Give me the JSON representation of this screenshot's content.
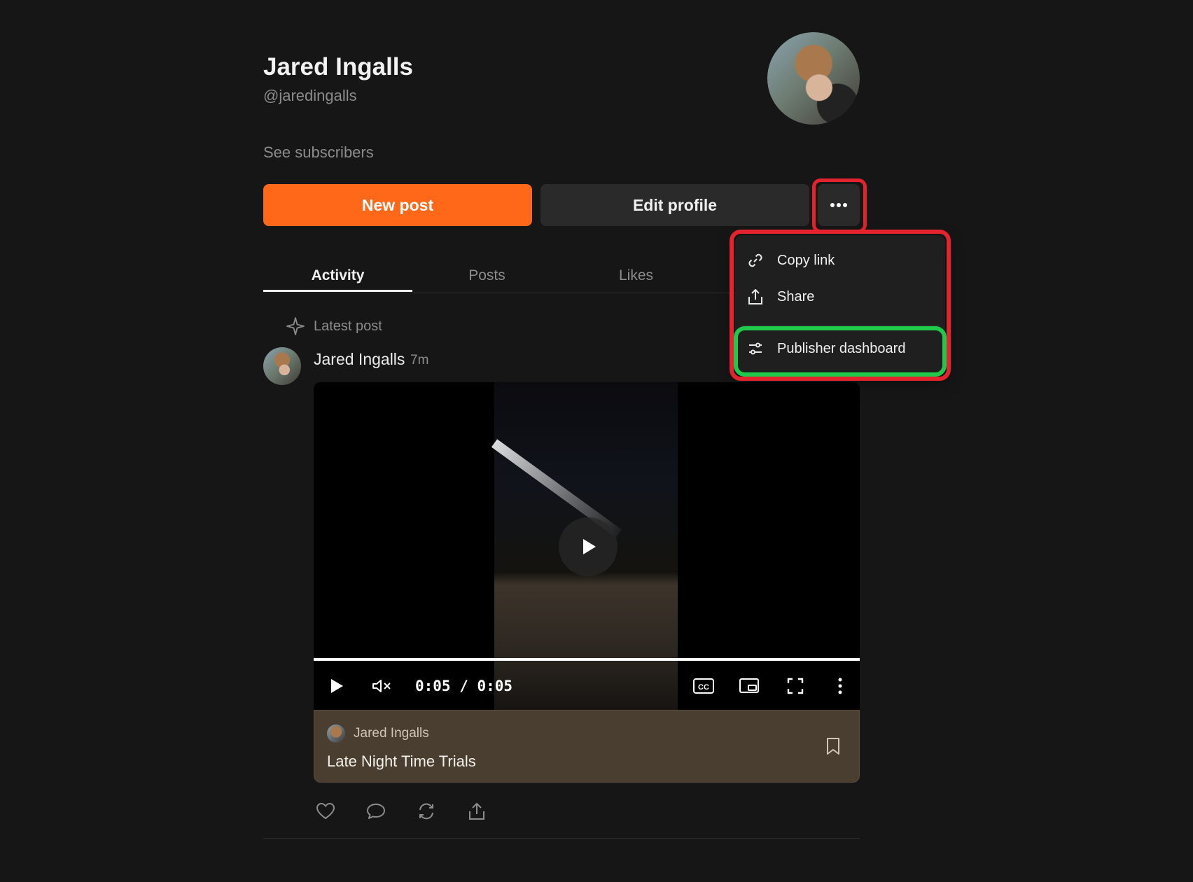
{
  "profile": {
    "name": "Jared Ingalls",
    "handle": "@jaredingalls",
    "see_subscribers": "See subscribers"
  },
  "actions": {
    "new_post": "New post",
    "edit_profile": "Edit profile",
    "more": "···"
  },
  "tabs": [
    {
      "label": "Activity",
      "active": true
    },
    {
      "label": "Posts",
      "active": false
    },
    {
      "label": "Likes",
      "active": false
    }
  ],
  "menu": {
    "items": [
      {
        "label": "Copy link",
        "icon": "link-icon"
      },
      {
        "label": "Share",
        "icon": "share-icon"
      },
      {
        "label": "Publisher dashboard",
        "icon": "sliders-icon"
      }
    ]
  },
  "feed": {
    "section_label": "Latest post",
    "post": {
      "author": "Jared Ingalls",
      "time": "7m",
      "video": {
        "time_display": "0:05 / 0:05",
        "progress_fraction": 1.0
      },
      "card": {
        "author": "Jared Ingalls",
        "title": "Late Night Time Trials"
      }
    }
  },
  "colors": {
    "accent": "#ff6719",
    "highlight_red": "#e3232d",
    "highlight_green": "#1fc94a",
    "background": "#161616"
  }
}
